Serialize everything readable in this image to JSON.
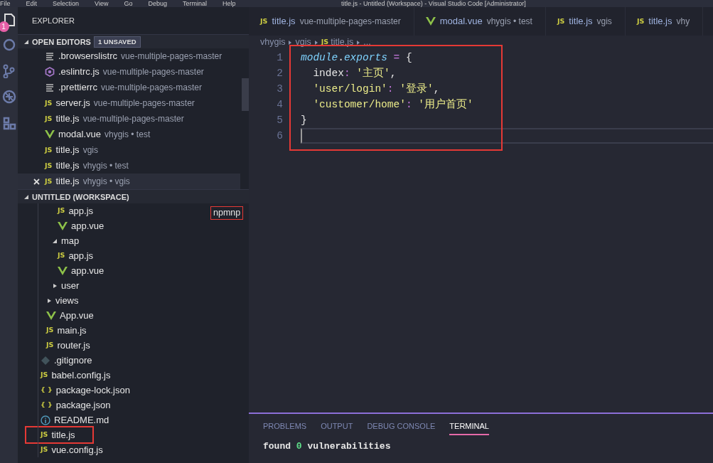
{
  "window": {
    "title": "title.js - Untitled (Workspace) - Visual Studio Code [Administrator]"
  },
  "menu": [
    "File",
    "Edit",
    "Selection",
    "View",
    "Go",
    "Debug",
    "Terminal",
    "Help"
  ],
  "activity_bar": {
    "badge": "1"
  },
  "sidebar": {
    "title": "EXPLORER",
    "open_editors": {
      "title": "OPEN EDITORS",
      "badge": "1 UNSAVED",
      "expanded": true,
      "items": [
        {
          "kind": "lines",
          "name": ".browserslistrc",
          "description": "vue-multiple-pages-master",
          "selected": false
        },
        {
          "kind": "eslint",
          "name": ".eslintrc.js",
          "description": "vue-multiple-pages-master",
          "selected": false
        },
        {
          "kind": "lines",
          "name": ".prettierrc",
          "description": "vue-multiple-pages-master",
          "selected": false
        },
        {
          "kind": "js",
          "icon_text": "JS",
          "name": "server.js",
          "description": "vue-multiple-pages-master",
          "selected": false
        },
        {
          "kind": "js",
          "icon_text": "JS",
          "name": "title.js",
          "description": "vue-multiple-pages-master",
          "selected": false
        },
        {
          "kind": "vue",
          "name": "modal.vue",
          "description": "vhygis • test",
          "selected": false
        },
        {
          "kind": "js",
          "icon_text": "JS",
          "name": "title.js",
          "description": "vgis",
          "selected": false
        },
        {
          "kind": "js",
          "icon_text": "JS",
          "name": "title.js",
          "description": "vhygis • test",
          "selected": false
        },
        {
          "kind": "js",
          "icon_text": "JS",
          "name": "title.js",
          "description": "vhygis • vgis",
          "selected": true
        }
      ]
    },
    "workspace": {
      "title": "UNTITLED (WORKSPACE)",
      "expanded": true,
      "note": "npmnp",
      "items": [
        {
          "kind": "group",
          "children": [
            {
              "kind": "group",
              "children": [
                {
                  "kind": "group",
                  "children": [
                    {
                      "kind": "js",
                      "icon_text": "JS",
                      "name": "app.js"
                    },
                    {
                      "kind": "vue",
                      "name": "app.vue"
                    }
                  ]
                },
                {
                  "kind": "folder",
                  "name": "map",
                  "expanded": true,
                  "children": [
                    {
                      "kind": "js",
                      "icon_text": "JS",
                      "name": "app.js"
                    },
                    {
                      "kind": "vue",
                      "name": "app.vue"
                    }
                  ]
                },
                {
                  "kind": "folder",
                  "name": "user",
                  "expanded": false
                }
              ]
            },
            {
              "kind": "folder",
              "name": "views",
              "expanded": false
            },
            {
              "kind": "vue",
              "name": "App.vue"
            },
            {
              "kind": "js",
              "icon_text": "JS",
              "name": "main.js"
            },
            {
              "kind": "js",
              "icon_text": "JS",
              "name": "router.js"
            }
          ]
        },
        {
          "kind": "git",
          "name": ".gitignore"
        },
        {
          "kind": "js",
          "icon_text": "JS",
          "name": "babel.config.js"
        },
        {
          "kind": "json",
          "icon_text": "{ }",
          "name": "package-lock.json"
        },
        {
          "kind": "json",
          "icon_text": "{ }",
          "name": "package.json"
        },
        {
          "kind": "info",
          "name": "README.md"
        },
        {
          "kind": "js",
          "icon_text": "JS",
          "name": "title.js",
          "annotated": true
        },
        {
          "kind": "js",
          "icon_text": "JS",
          "name": "vue.config.js"
        }
      ]
    }
  },
  "tabs": [
    {
      "kind": "js",
      "icon_text": "JS",
      "name": "title.js",
      "description": "vue-multiple-pages-master",
      "selected": false
    },
    {
      "kind": "vue",
      "name": "modal.vue",
      "description": "vhygis • test",
      "selected": false
    },
    {
      "kind": "js",
      "icon_text": "JS",
      "name": "title.js",
      "description": "vgis",
      "selected": false
    },
    {
      "kind": "js",
      "icon_text": "JS",
      "name": "title.js",
      "description": "vhy",
      "selected": false
    }
  ],
  "breadcrumbs": [
    {
      "text": "vhygis"
    },
    {
      "text": "vgis"
    },
    {
      "kind": "js",
      "icon_text": "JS",
      "text": "title.js"
    },
    {
      "text": "..."
    }
  ],
  "editor": {
    "annotated": true,
    "lines": [
      {
        "number": "1",
        "active": false,
        "tokens": [
          {
            "kind": "object",
            "text": "module"
          },
          {
            "kind": "punct",
            "text": "."
          },
          {
            "kind": "object",
            "text": "exports"
          },
          {
            "kind": "operator",
            "text": " = "
          },
          {
            "kind": "punct",
            "text": "{"
          }
        ]
      },
      {
        "number": "2",
        "active": false,
        "tokens": [
          {
            "kind": "key",
            "text": "  index"
          },
          {
            "kind": "operator",
            "text": ": "
          },
          {
            "kind": "string",
            "text": "'主页'"
          },
          {
            "kind": "punct",
            "text": ","
          }
        ]
      },
      {
        "number": "3",
        "active": false,
        "tokens": [
          {
            "kind": "string",
            "text": "  'user/login'"
          },
          {
            "kind": "operator",
            "text": ": "
          },
          {
            "kind": "string",
            "text": "'登录'"
          },
          {
            "kind": "punct",
            "text": ","
          }
        ]
      },
      {
        "number": "4",
        "active": false,
        "tokens": [
          {
            "kind": "string",
            "text": "  'customer/home'"
          },
          {
            "kind": "operator",
            "text": ": "
          },
          {
            "kind": "string",
            "text": "'用户首页'"
          }
        ]
      },
      {
        "number": "5",
        "active": false,
        "tokens": [
          {
            "kind": "punct",
            "text": "}"
          }
        ]
      },
      {
        "number": "6",
        "active": true
      }
    ]
  },
  "panel": {
    "tabs": [
      {
        "label": "PROBLEMS",
        "selected": false
      },
      {
        "label": "OUTPUT",
        "selected": false
      },
      {
        "label": "DEBUG CONSOLE",
        "selected": false
      },
      {
        "label": "TERMINAL",
        "selected": true
      }
    ],
    "terminal": [
      {
        "tokens": [
          {
            "kind": "plain",
            "text": "found "
          },
          {
            "kind": "number",
            "text": "0"
          },
          {
            "kind": "plain",
            "text": " vulnerabilities"
          }
        ]
      }
    ]
  }
}
